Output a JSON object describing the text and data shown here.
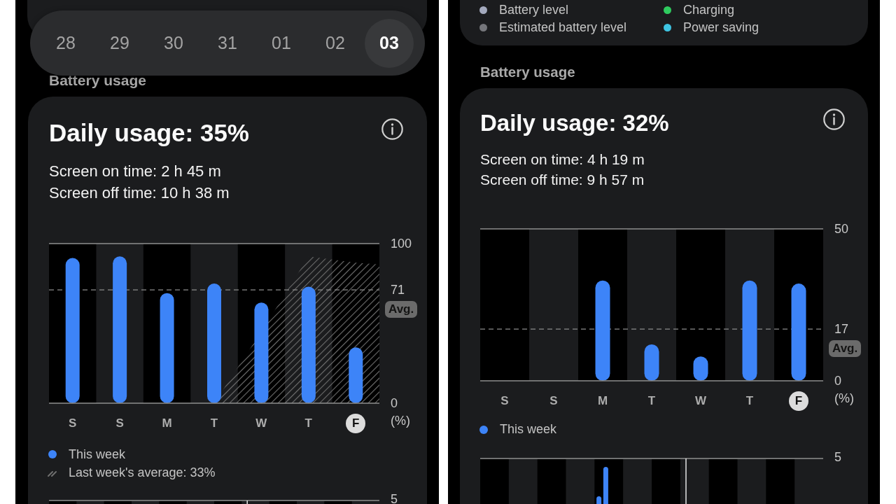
{
  "screens": [
    {
      "date_strip": [
        {
          "label": "28",
          "selected": false
        },
        {
          "label": "29",
          "selected": false
        },
        {
          "label": "30",
          "selected": false
        },
        {
          "label": "31",
          "selected": false
        },
        {
          "label": "01",
          "selected": false
        },
        {
          "label": "02",
          "selected": false
        },
        {
          "label": "03",
          "selected": true
        }
      ],
      "section_title": "Battery usage",
      "usage_card": {
        "title": "Daily usage: 35%",
        "details": [
          "Screen on time: 2 h 45 m",
          "Screen off time: 10 h 38 m"
        ],
        "chart_data": {
          "type": "bar",
          "categories": [
            "S",
            "S",
            "M",
            "T",
            "W",
            "T",
            "F"
          ],
          "series": [
            {
              "name": "This week",
              "color": "#3d84f8",
              "values": [
                91,
                92,
                69,
                75,
                63,
                73,
                35
              ]
            }
          ],
          "ylim": [
            0,
            100
          ],
          "yticks": [
            0,
            71,
            100
          ],
          "ylabel": "(%)"
        },
        "average_badge": "Avg.",
        "day_tabs": [
          {
            "selected": false
          },
          {
            "selected": false
          },
          {
            "selected": false
          },
          {
            "selected": false
          },
          {
            "selected": false
          },
          {
            "selected": false
          },
          {
            "selected": true
          }
        ],
        "last_week_overlay": {
          "label": "Last week's average: 33%"
        },
        "hourly_chart": {
          "top_label": "5"
        }
      }
    },
    {
      "graph_legend": [
        {
          "label": "Battery level",
          "color": "#a3a9bd"
        },
        {
          "label": "Charging",
          "color": "#2fcb5f"
        },
        {
          "label": "Estimated battery level",
          "color": "#75767b"
        },
        {
          "label": "Power saving",
          "color": "#3ec4e2"
        }
      ],
      "section_title": "Battery usage",
      "usage_card": {
        "title": "Daily usage: 32%",
        "details": [
          "Screen on time: 4 h 19 m",
          "Screen off time: 9 h 57 m"
        ],
        "chart_data": {
          "type": "bar",
          "categories": [
            "S",
            "S",
            "M",
            "T",
            "W",
            "T",
            "F"
          ],
          "series": [
            {
              "name": "This week",
              "color": "#3d84f8",
              "values": [
                0,
                0,
                33,
                12,
                8,
                33,
                32
              ]
            }
          ],
          "ylim": [
            0,
            50
          ],
          "yticks": [
            0,
            17,
            50
          ],
          "ylabel": "(%)"
        },
        "average_badge": "Avg.",
        "day_tabs": [
          {
            "selected": false
          },
          {
            "selected": false
          },
          {
            "selected": false
          },
          {
            "selected": false
          },
          {
            "selected": false
          },
          {
            "selected": false
          },
          {
            "selected": true
          }
        ],
        "hourly_chart": {
          "top_label": "5"
        }
      }
    }
  ]
}
